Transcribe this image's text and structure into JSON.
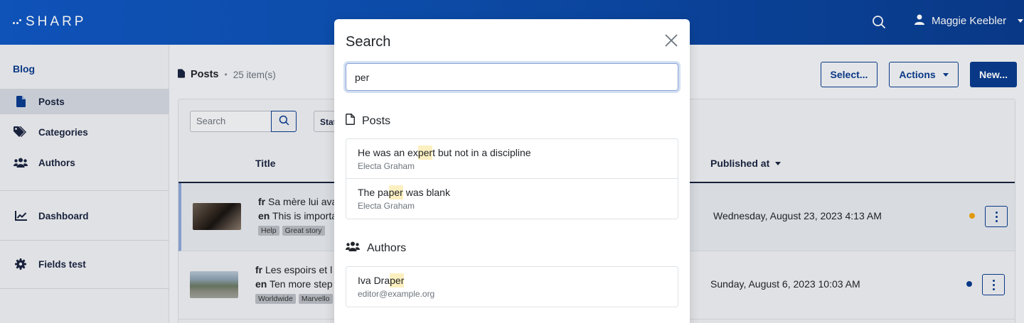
{
  "brand": {
    "name": "SHARP"
  },
  "header": {
    "user_name": "Maggie Keebler"
  },
  "sidebar": {
    "section_title": "Blog",
    "items": [
      {
        "label": "Posts",
        "icon": "file-icon",
        "active": true
      },
      {
        "label": "Categories",
        "icon": "tags-icon"
      },
      {
        "label": "Authors",
        "icon": "users-icon"
      },
      {
        "label": "Dashboard",
        "icon": "chart-line-icon"
      },
      {
        "label": "Fields test",
        "icon": "gear-icon"
      }
    ]
  },
  "page": {
    "title": "Posts",
    "separator": "•",
    "count": "25 item(s)",
    "select_label": "Select...",
    "actions_label": "Actions",
    "new_label": "New..."
  },
  "list": {
    "search_placeholder": "Search",
    "state_filter_label": "State",
    "columns": {
      "title": "Title",
      "published_at": "Published at"
    },
    "rows": [
      {
        "fr_lang": "fr",
        "fr_text": "Sa mère lui ava",
        "en_lang": "en",
        "en_text": "This is importa",
        "tags": [
          "Help",
          "Great story"
        ],
        "date": "Wednesday, August 23, 2023 4:13 AM",
        "state_color": "#f0a30a"
      },
      {
        "fr_lang": "fr",
        "fr_text": "Les espoirs et l",
        "en_lang": "en",
        "en_text": "Ten more step",
        "tags": [
          "Worldwide",
          "Marvello"
        ],
        "date": "Sunday, August 6, 2023 10:03 AM",
        "state_color": "#0a3c8f"
      }
    ]
  },
  "search_modal": {
    "title": "Search",
    "query": "per",
    "posts_section": "Posts",
    "posts": [
      {
        "pre": "He was an ex",
        "match": "per",
        "post": "t but not in a discipline",
        "sub": "Electa Graham"
      },
      {
        "pre": "The pa",
        "match": "per",
        "post": " was blank",
        "sub": "Electa Graham"
      }
    ],
    "authors_section": "Authors",
    "authors": [
      {
        "pre": "Iva Dra",
        "match": "per",
        "post": "",
        "sub": "editor@example.org"
      }
    ]
  },
  "colors": {
    "brand_blue": "#0a3c8f",
    "topbar_start": "#1058c4",
    "highlight": "#fdf0c0"
  }
}
